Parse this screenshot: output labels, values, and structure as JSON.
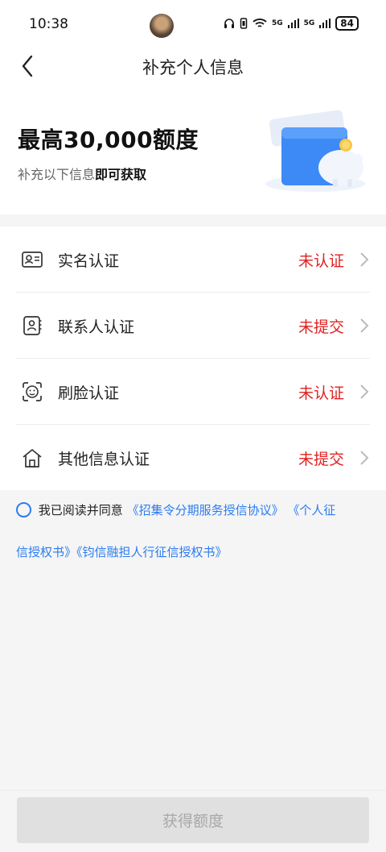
{
  "status_bar": {
    "time": "10:38",
    "network_1": "5G",
    "network_2": "5G",
    "battery": "84"
  },
  "nav": {
    "title": "补充个人信息",
    "back_icon": "chevron-left-icon"
  },
  "hero": {
    "title": "最高30,000额度",
    "subtitle_prefix": "补充以下信息",
    "subtitle_bold": "即可获取",
    "illustration": "wallet-piggybank-illustration"
  },
  "verification_items": [
    {
      "label": "实名认证",
      "status": "未认证",
      "icon": "id-card-icon"
    },
    {
      "label": "联系人认证",
      "status": "未提交",
      "icon": "contact-book-icon"
    },
    {
      "label": "刷脸认证",
      "status": "未认证",
      "icon": "face-scan-icon"
    },
    {
      "label": "其他信息认证",
      "status": "未提交",
      "icon": "house-icon"
    }
  ],
  "agreement": {
    "prefix": "我已阅读并同意",
    "link_1": "《招集令分期服务授信协议》",
    "link_2": "《个人征信授权书》",
    "link_3": "《钧信融担人行征信授权书》"
  },
  "submit": {
    "label": "获得额度"
  },
  "colors": {
    "status_red": "#e02020",
    "link_blue": "#2b7cf0",
    "button_disabled_bg": "#e0e0e0"
  }
}
